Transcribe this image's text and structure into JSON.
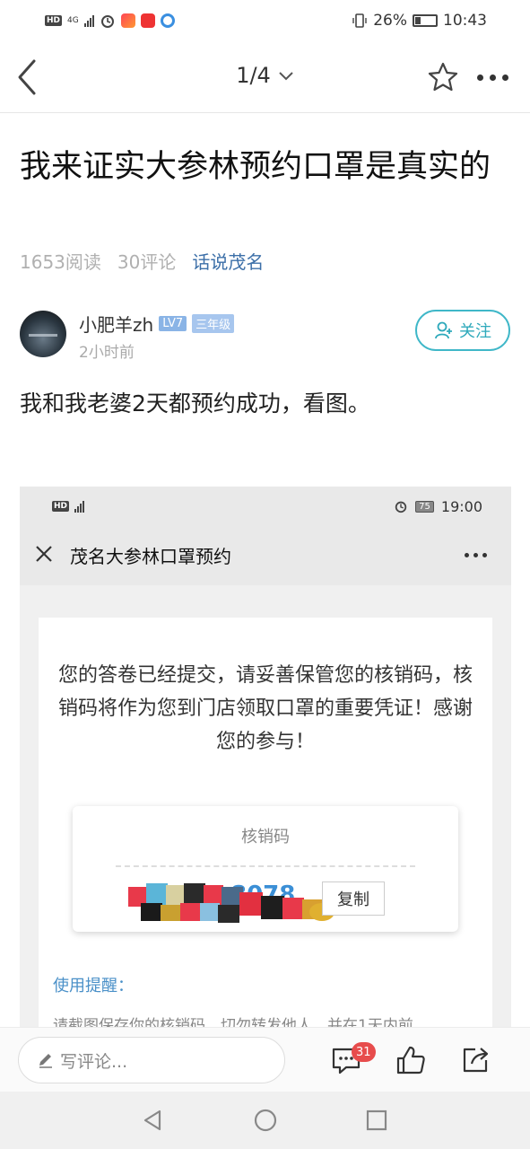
{
  "status_bar": {
    "network": "4G",
    "hd": "HD",
    "battery": "26%",
    "time": "10:43"
  },
  "nav": {
    "page_indicator": "1/4"
  },
  "article": {
    "title": "我来证实大参林预约口罩是真实的",
    "reads": "1653阅读",
    "comments": "30评论",
    "topic": "话说茂名",
    "body": "我和我老婆2天都预约成功，看图。"
  },
  "author": {
    "name": "小肥羊zh",
    "level": "LV7",
    "tenure": "三年级",
    "time": "2小时前",
    "follow_label": "关注"
  },
  "screenshot": {
    "status_left": "HD",
    "battery": "75",
    "time": "19:00",
    "title": "茂名大参林口罩预约",
    "message": "您的答卷已经提交，请妥善保管您的核销码，核销码将作为您到门店领取口罩的重要凭证！感谢您的参与！",
    "code_label": "核销码",
    "code_value": "…8078",
    "copy_label": "复制",
    "tips_heading": "使用提醒：",
    "tips_text": "请截图保存你的核销码，切勿转发他人，并在1天内前"
  },
  "bottom_bar": {
    "comment_placeholder": "写评论...",
    "comment_count": "31"
  },
  "colors": {
    "accent": "#3fb7c8",
    "topic": "#3c6fa8",
    "badge": "#e74c4c"
  }
}
